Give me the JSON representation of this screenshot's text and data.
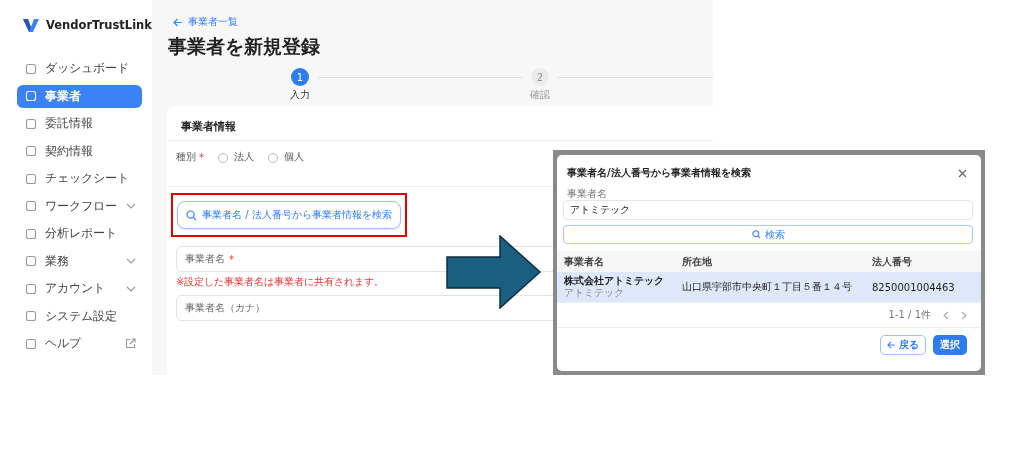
{
  "app": {
    "logo": "VendorTrustLink"
  },
  "sidebar": {
    "items": [
      {
        "label": "ダッシュボード",
        "selected": false,
        "kind": "plain"
      },
      {
        "label": "事業者",
        "selected": true,
        "kind": "plain"
      },
      {
        "label": "委託情報",
        "selected": false,
        "kind": "plain"
      },
      {
        "label": "契約情報",
        "selected": false,
        "kind": "plain"
      },
      {
        "label": "チェックシート",
        "selected": false,
        "kind": "plain"
      },
      {
        "label": "ワークフロー",
        "selected": false,
        "kind": "group"
      },
      {
        "label": "分析レポート",
        "selected": false,
        "kind": "plain"
      },
      {
        "label": "業務",
        "selected": false,
        "kind": "group"
      },
      {
        "label": "アカウント",
        "selected": false,
        "kind": "group"
      },
      {
        "label": "システム設定",
        "selected": false,
        "kind": "plain"
      },
      {
        "label": "ヘルプ",
        "selected": false,
        "kind": "external"
      }
    ]
  },
  "page": {
    "back_link": "事業者一覧",
    "title": "事業者を新規登録",
    "steps": [
      {
        "number": "1",
        "label": "入力",
        "selected": true
      },
      {
        "number": "2",
        "label": "確認",
        "selected": false
      }
    ],
    "section": {
      "title": "事業者情報",
      "type_field": {
        "label": "種別",
        "required_mark": "*",
        "options": [
          {
            "label": "法人",
            "selected": false
          },
          {
            "label": "個人",
            "selected": false
          }
        ]
      },
      "search_button": {
        "label": "事業者名 / 法人番号から事業者情報を検索",
        "highlighted": true
      },
      "name_field": {
        "placeholder": "事業者名",
        "required_mark": "*",
        "note": "※設定した事業者名は事業者に共有されます。"
      },
      "kana_field": {
        "placeholder": "事業者名（カナ）"
      }
    }
  },
  "dialog": {
    "title": "事業者名/法人番号から事業者情報を検索",
    "field_label": "事業者名",
    "field_value": "アトミテック",
    "search_button": "検索",
    "columns": [
      "事業者名",
      "所在地",
      "法人番号"
    ],
    "rows": [
      {
        "name": "株式会社アトミテック",
        "kana": "アトミテック",
        "address": "山口県宇部市中央町１丁目５番１４号",
        "number": "8250001004463",
        "selected": true
      }
    ],
    "pagination": "1-1 / 1件",
    "back_button": "戻る",
    "select_button": "選択"
  }
}
